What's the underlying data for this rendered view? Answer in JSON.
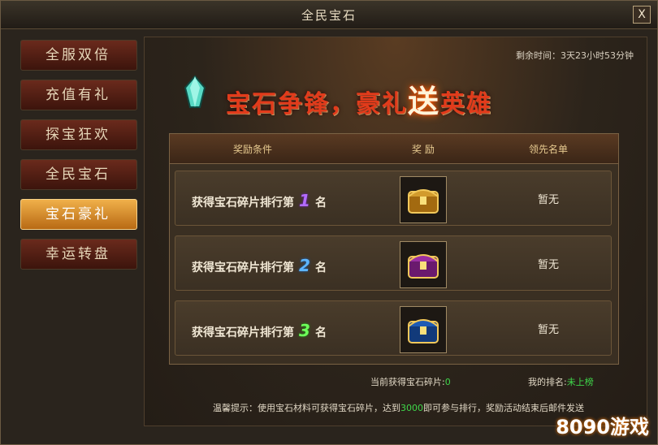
{
  "window": {
    "title": "全民宝石",
    "close_label": "X"
  },
  "sidebar": {
    "items": [
      {
        "label": "全服双倍",
        "active": false
      },
      {
        "label": "充值有礼",
        "active": false
      },
      {
        "label": "探宝狂欢",
        "active": false
      },
      {
        "label": "全民宝石",
        "active": false
      },
      {
        "label": "宝石豪礼",
        "active": true
      },
      {
        "label": "幸运转盘",
        "active": false
      }
    ]
  },
  "main": {
    "timer": "剩余时间：3天23小时53分钟",
    "banner": {
      "part1": "宝石争锋，豪礼",
      "highlight": "送",
      "part2": "英雄"
    },
    "table": {
      "headers": [
        "奖励条件",
        "奖 励",
        "领先名单"
      ],
      "rows": [
        {
          "prefix": "获得宝石碎片排行第",
          "rank": "1",
          "suffix": "名",
          "leader": "暂无",
          "reward_icon": "gold-chest-icon"
        },
        {
          "prefix": "获得宝石碎片排行第",
          "rank": "2",
          "suffix": "名",
          "leader": "暂无",
          "reward_icon": "purple-chest-icon"
        },
        {
          "prefix": "获得宝石碎片排行第",
          "rank": "3",
          "suffix": "名",
          "leader": "暂无",
          "reward_icon": "blue-chest-icon"
        }
      ]
    },
    "current_fragments_label": "当前获得宝石碎片:",
    "current_fragments_value": "0",
    "my_rank_label": "我的排名:",
    "my_rank_value": "未上榜",
    "tip_prefix": "温馨提示：使用宝石材料可获得宝石碎片，达到",
    "tip_value": "3000",
    "tip_suffix": "即可参与排行，奖励活动结束后邮件发送"
  },
  "watermark": "8090游戏"
}
